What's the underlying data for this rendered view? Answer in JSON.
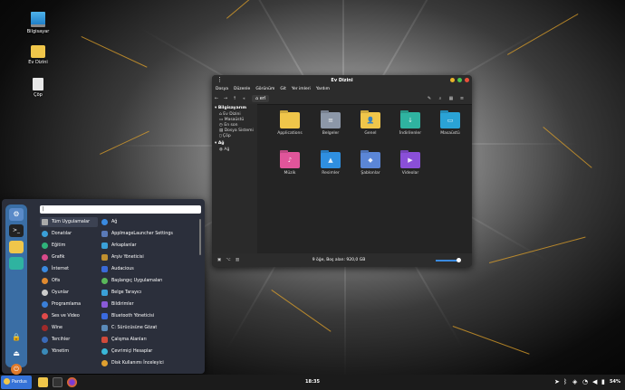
{
  "desktop": {
    "icons": [
      {
        "label": "Bilgisayar",
        "icon": "computer-icon"
      },
      {
        "label": "Ev Dizini",
        "icon": "home-folder-icon"
      },
      {
        "label": "Çöp",
        "icon": "trash-icon"
      }
    ]
  },
  "file_manager": {
    "title": "Ev Dizini",
    "menu": [
      "Dosya",
      "Düzenle",
      "Görünüm",
      "Git",
      "Yer imleri",
      "Yardım"
    ],
    "breadcrumb": "erl",
    "sidebar": {
      "section1": "Bilgisayarım",
      "items1": [
        "Ev Dizini",
        "Masaüstü",
        "En son",
        "Dosya Sistemi",
        "Çöp"
      ],
      "section2": "Ağ",
      "items2": [
        "Ağ"
      ]
    },
    "folders": [
      {
        "label": "Applications",
        "color": "#f0c64a",
        "glyph": ""
      },
      {
        "label": "Belgeler",
        "color": "#8c97a8",
        "glyph": "≡"
      },
      {
        "label": "Genel",
        "color": "#f0c64a",
        "glyph": "👤"
      },
      {
        "label": "İndirilenler",
        "color": "#2fb3a0",
        "glyph": "↓"
      },
      {
        "label": "Masaüstü",
        "color": "#2aa3d6",
        "glyph": "▭"
      },
      {
        "label": "Müzik",
        "color": "#e0559a",
        "glyph": "♪"
      },
      {
        "label": "Resimler",
        "color": "#2f8fe0",
        "glyph": "▲"
      },
      {
        "label": "Şablonlar",
        "color": "#5b86d6",
        "glyph": "◆"
      },
      {
        "label": "Videolar",
        "color": "#8a4fd8",
        "glyph": "▶"
      }
    ],
    "status": "9 öğe, Boş alan: 920,0 GB"
  },
  "app_menu": {
    "search_value": "|",
    "categories": [
      {
        "label": "Tüm Uygulamalar",
        "color": "#aaaaaa"
      },
      {
        "label": "Donatılar",
        "color": "#3aa0d8"
      },
      {
        "label": "Eğitim",
        "color": "#2fb37a"
      },
      {
        "label": "Grafik",
        "color": "#d84a8a"
      },
      {
        "label": "İnternet",
        "color": "#3a8ae0"
      },
      {
        "label": "Ofis",
        "color": "#e08a2f"
      },
      {
        "label": "Oyunlar",
        "color": "#cccccc"
      },
      {
        "label": "Programlama",
        "color": "#3a7fd8"
      },
      {
        "label": "Ses ve Video",
        "color": "#e04a4a"
      },
      {
        "label": "Wine",
        "color": "#a02a2a"
      },
      {
        "label": "Tercihler",
        "color": "#3a6ab8"
      },
      {
        "label": "Yönetim",
        "color": "#3a8ab8"
      }
    ],
    "apps": [
      {
        "label": "Ağ",
        "color": "#3a8ae0"
      },
      {
        "label": "AppImageLauncher Settings",
        "color": "#5a7ab8"
      },
      {
        "label": "Arkaplanlar",
        "color": "#3aa0d8"
      },
      {
        "label": "Arşiv Yöneticisi",
        "color": "#c0902f"
      },
      {
        "label": "Audacious",
        "color": "#3a6ad8"
      },
      {
        "label": "Başlangıç Uygulamaları",
        "color": "#5ab85a"
      },
      {
        "label": "Belge Tarayıcı",
        "color": "#3aa0d8"
      },
      {
        "label": "Bildirimler",
        "color": "#8a5ad8"
      },
      {
        "label": "Bluetooth Yöneticisi",
        "color": "#3a6ae0"
      },
      {
        "label": "C: Sürücüsüne Gözat",
        "color": "#5a8ab8"
      },
      {
        "label": "Çalışma Alanları",
        "color": "#d04a3a"
      },
      {
        "label": "Çevrimiçi Hesaplar",
        "color": "#3ab8d8"
      },
      {
        "label": "Disk Kullanımı İnceleyici",
        "color": "#e0a02f"
      }
    ]
  },
  "taskbar": {
    "start_label": "Pardus",
    "clock": "18:35",
    "battery": "54%"
  }
}
